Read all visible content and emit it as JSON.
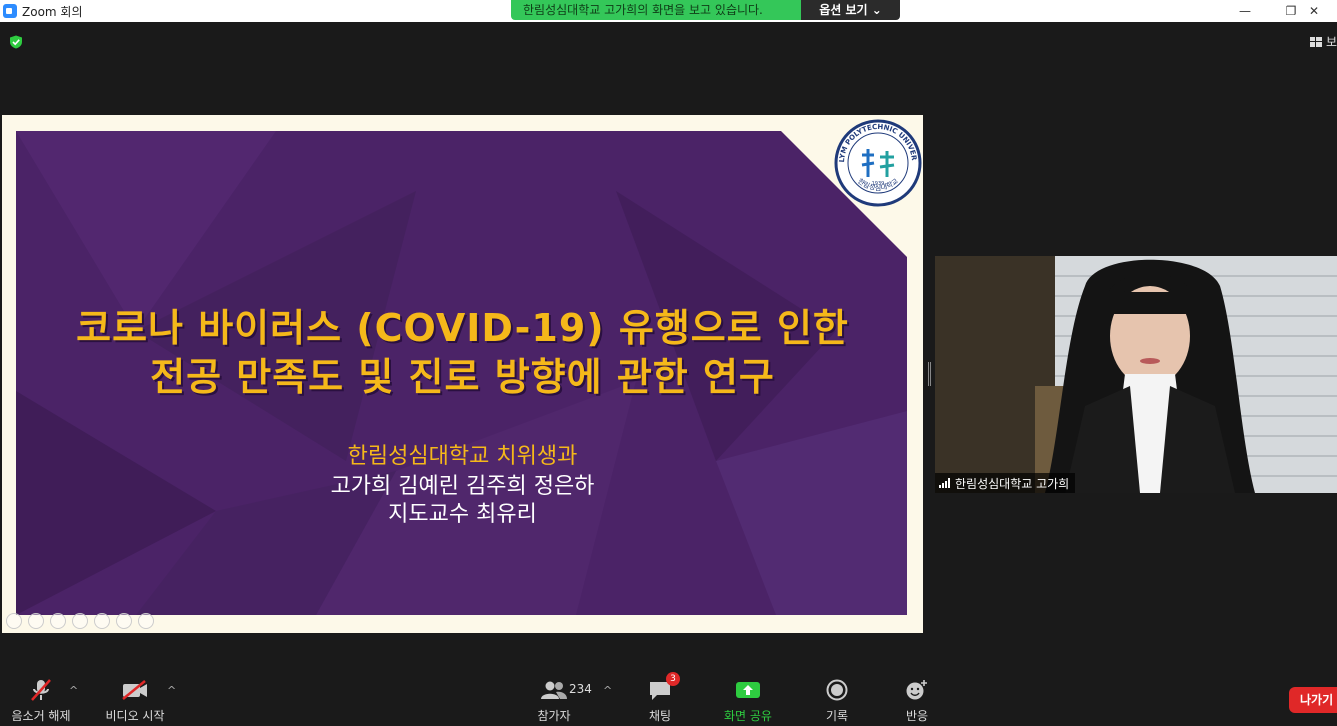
{
  "window": {
    "title": "Zoom 회의",
    "minimize": "—",
    "restore": "❐",
    "close": "✕"
  },
  "share_banner": {
    "message": "한림성심대학교 고가희의 화면을 보고 있습니다.",
    "options_label": "옵션 보기 ⌄"
  },
  "view": {
    "label": "보"
  },
  "slide": {
    "title_line1": "코로나 바이러스 (COVID-19) 유행으로 인한",
    "title_line2": "전공 만족도 및 진로 방향에 관한 연구",
    "subtitle_school": "한림성심대학교 치위생과",
    "authors": "고가희 김예린 김주희 정은하",
    "advisor": "지도교수 최유리",
    "logo_text_top": "HALLYM POLYTECHNIC UNIVERSITY",
    "logo_text_bottom": "한림성심대학교",
    "logo_year": "1939"
  },
  "participant": {
    "name": "한림성심대학교 고가희"
  },
  "toolbar": {
    "mute_label": "음소거 해제",
    "video_label": "비디오 시작",
    "participants_label": "참가자",
    "participants_count": "234",
    "chat_label": "채팅",
    "chat_badge": "3",
    "share_label": "화면 공유",
    "record_label": "기록",
    "reactions_label": "반응",
    "leave_label": "나가기",
    "caret": "^"
  },
  "colors": {
    "share_green": "#34c759",
    "slide_purple": "#4b2367",
    "title_yellow": "#f5b81a",
    "leave_red": "#e02828"
  }
}
